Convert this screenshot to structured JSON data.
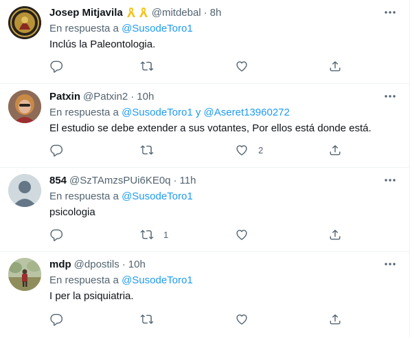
{
  "reply_prefix": "En respuesta a",
  "and_word": "y",
  "colors": {
    "link": "#1d9bf0",
    "muted": "#536471",
    "text": "#0f1419",
    "border": "#eff3f4"
  },
  "tweets": [
    {
      "name": "Josep Mitjavila",
      "badges": [
        "yellow-ribbon-icon",
        "yellow-ribbon-icon"
      ],
      "handle": "@mitdebal",
      "time": "8h",
      "reply_to": [
        "@SusodeToro1"
      ],
      "text": "Inclús la Paleontologia.",
      "reply_count": "",
      "retweet_count": "",
      "like_count": ""
    },
    {
      "name": "Patxin",
      "handle": "@Patxin2",
      "time": "10h",
      "reply_to": [
        "@SusodeToro1",
        "@Aseret13960272"
      ],
      "text": "El estudio se debe extender a sus votantes, Por ellos está donde está.",
      "reply_count": "",
      "retweet_count": "",
      "like_count": "2"
    },
    {
      "name": "854",
      "handle": "@SzTAmzsPUi6KE0q",
      "time": "11h",
      "reply_to": [
        "@SusodeToro1"
      ],
      "text": "psicologia",
      "reply_count": "",
      "retweet_count": "1",
      "like_count": ""
    },
    {
      "name": "mdp",
      "handle": "@dpostils",
      "time": "10h",
      "reply_to": [
        "@SusodeToro1"
      ],
      "text": "I per la psiquiatria.",
      "reply_count": "",
      "retweet_count": "",
      "like_count": ""
    }
  ]
}
